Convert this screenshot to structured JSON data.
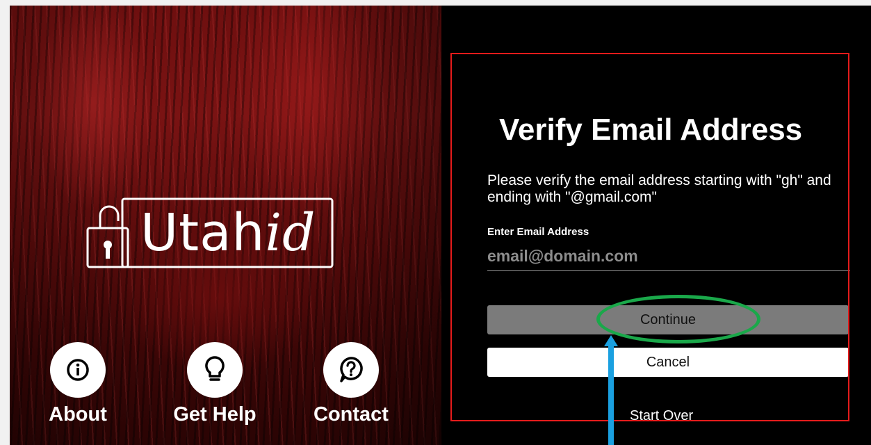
{
  "brand": {
    "logo_text_main": "Utah",
    "logo_text_italic": "id"
  },
  "quick_links": [
    {
      "label": "About",
      "icon": "info-icon"
    },
    {
      "label": "Get Help",
      "icon": "lightbulb-icon"
    },
    {
      "label": "Contact",
      "icon": "question-bubble-icon"
    }
  ],
  "verify": {
    "title": "Verify Email Address",
    "instructions": "Please verify the email address starting with \"gh\" and ending with \"@gmail.com\"",
    "field_label": "Enter Email Address",
    "email_placeholder": "email@domain.com",
    "email_value": "",
    "continue_label": "Continue",
    "cancel_label": "Cancel",
    "start_over_label": "Start Over"
  },
  "colors": {
    "highlight_box": "#e51b1b",
    "annotation_ellipse": "#1aa84a",
    "annotation_arrow": "#1aa0e0",
    "continue_button_bg": "#7b7b7b"
  }
}
